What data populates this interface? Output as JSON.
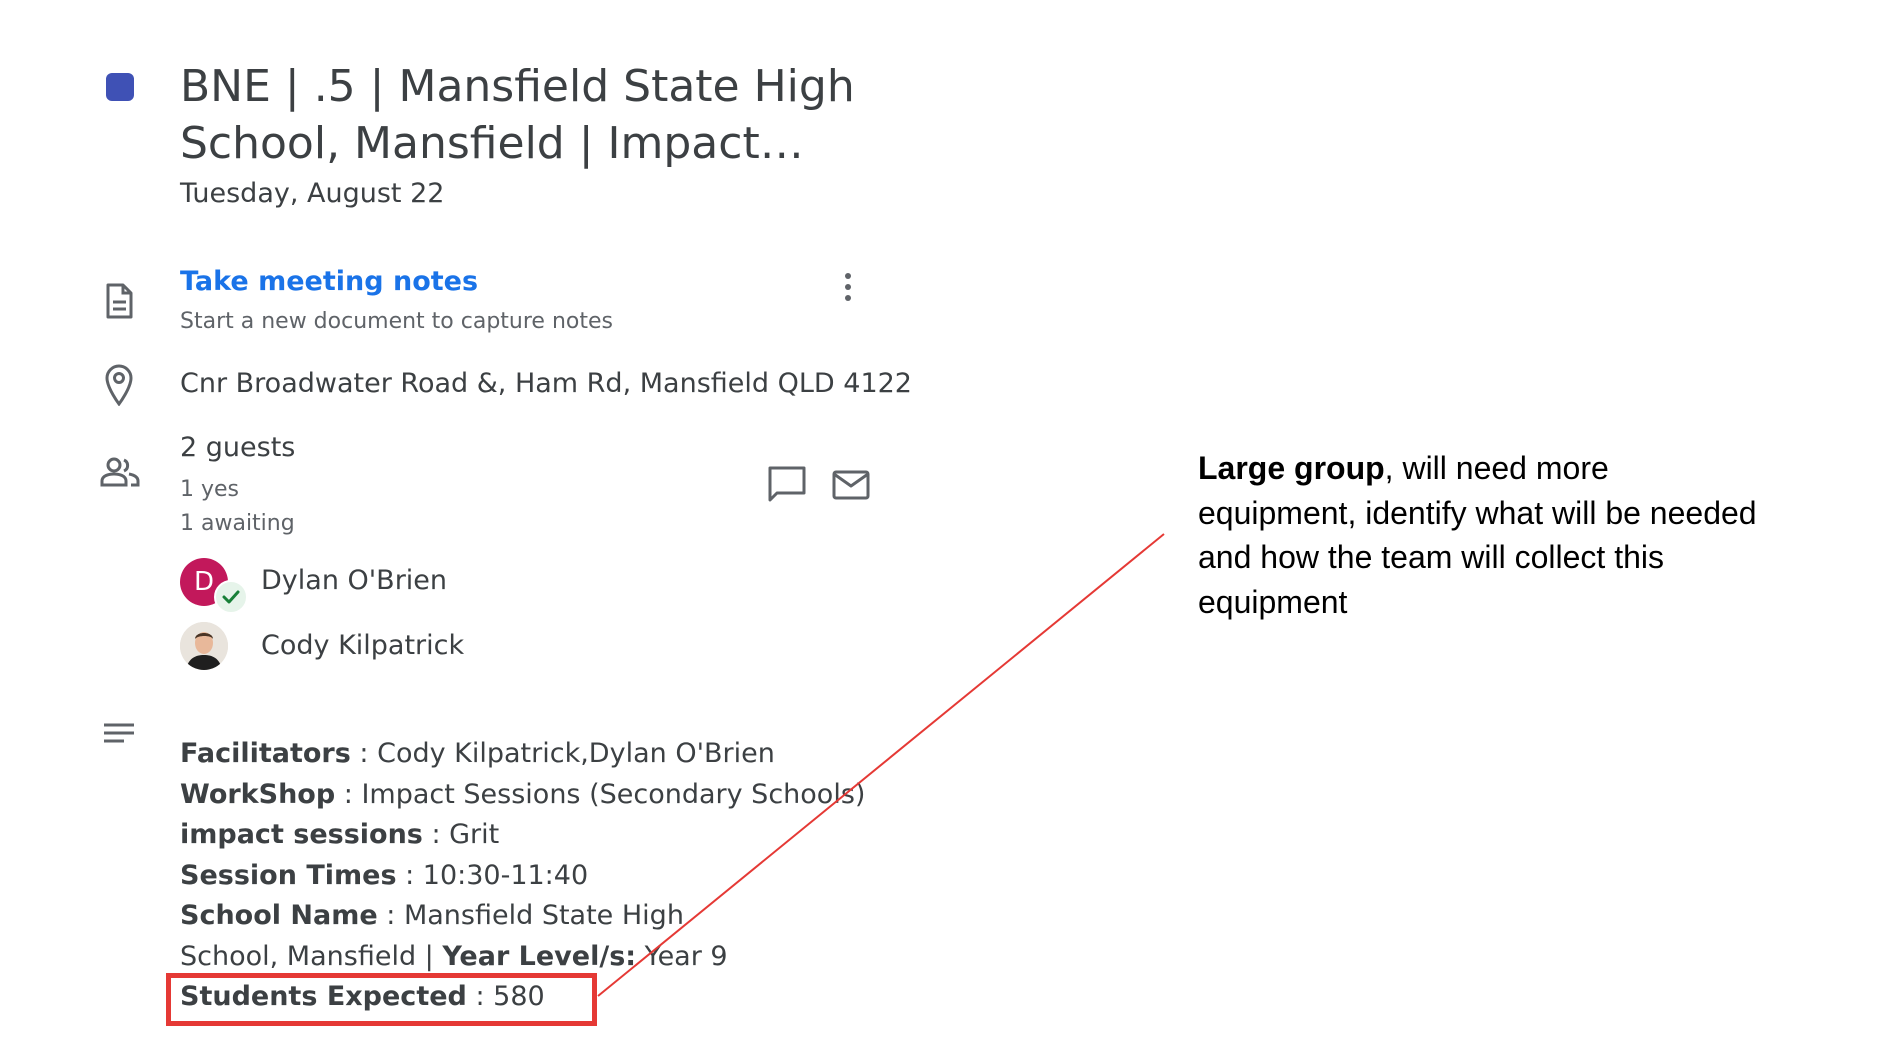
{
  "event": {
    "calendar_color": "#3f51b5",
    "title": "BNE | .5 | Mansfield State High School, Mansfield | Impact…",
    "date": "Tuesday, August 22"
  },
  "notes": {
    "link_label": "Take meeting notes",
    "subtitle": "Start a new document to capture notes",
    "options_icon": "more-vert-icon"
  },
  "location": {
    "icon": "location-pin-icon",
    "address": "Cnr Broadwater Road &, Ham Rd, Mansfield QLD 4122"
  },
  "guests": {
    "icon": "people-icon",
    "summary": "2 guests",
    "yes": "1 yes",
    "awaiting": "1 awaiting",
    "chat_icon": "chat-bubble-icon",
    "email_icon": "email-icon",
    "list": [
      {
        "initial": "D",
        "name": "Dylan O'Brien",
        "avatar_color": "#c2185b",
        "status": "accepted"
      },
      {
        "name": "Cody Kilpatrick",
        "avatar": "photo"
      }
    ]
  },
  "description": {
    "icon": "description-lines-icon",
    "facilitators_label": "Facilitators",
    "facilitators_value": " : Cody Kilpatrick,Dylan O'Brien",
    "workshop_label": "WorkShop",
    "workshop_value": " : Impact Sessions (Secondary Schools)",
    "impact_label": "impact sessions",
    "impact_value": " : Grit",
    "times_label": "Session Times",
    "times_value": " : 10:30-11:40",
    "school_label": "School Name",
    "school_value": " : Mansfield State High School, Mansfield | ",
    "year_label": "Year Level/s:",
    "year_value": " Year 9",
    "students_label": "Students Expected",
    "students_value": " : 580"
  },
  "annotation": {
    "highlight_color": "#e53935",
    "bold_text": "Large group",
    "text": ", will need more equipment, identify what will be needed and how the team will collect this equipment"
  }
}
